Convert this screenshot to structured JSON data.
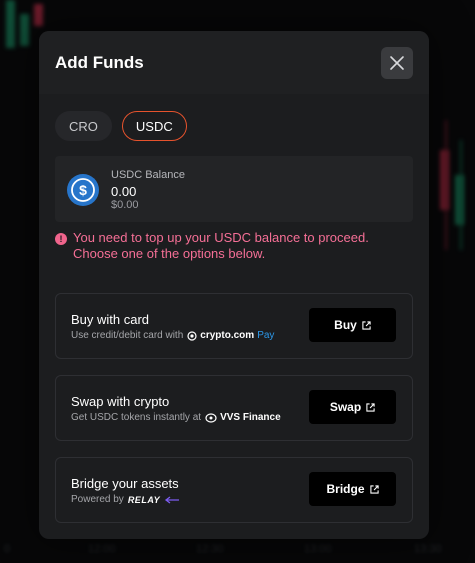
{
  "modal": {
    "title": "Add Funds"
  },
  "tabs": [
    {
      "label": "CRO",
      "active": false
    },
    {
      "label": "USDC",
      "active": true
    }
  ],
  "balance": {
    "label": "USDC Balance",
    "amount": "0.00",
    "usd_value": "$0.00",
    "icon": "usdc-icon"
  },
  "warning": {
    "message": "You need to top up your USDC balance to proceed. Choose one of the options below.",
    "icon": "alert-icon"
  },
  "options": [
    {
      "title": "Buy with card",
      "subtitle": "Use credit/debit card with",
      "brand": "crypto.com",
      "brand_suffix": "Pay",
      "button": "Buy"
    },
    {
      "title": "Swap with crypto",
      "subtitle": "Get USDC tokens instantly at",
      "brand": "VVS Finance",
      "button": "Swap"
    },
    {
      "title": "Bridge your assets",
      "subtitle": "Powered by",
      "brand": "RELAY",
      "button": "Bridge"
    }
  ],
  "background_axis": [
    "0",
    "12:00",
    "12:30",
    "13:00",
    "13:30"
  ],
  "colors": {
    "accent": "#e6532d",
    "warning": "#f56f96",
    "usdc": "#2775ca",
    "pay": "#2c97e8"
  }
}
